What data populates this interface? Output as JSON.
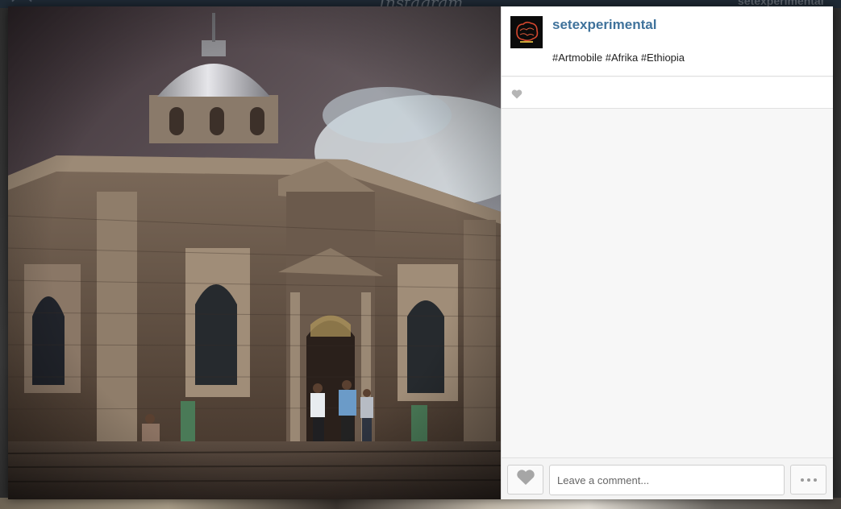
{
  "background": {
    "brand": "Instagram",
    "username": "setexperimental"
  },
  "post": {
    "username": "setexperimental",
    "caption": "#Artmobile #Afrika #Ethiopia",
    "avatar_icon": "brain-logo-icon",
    "photo_subject": "stone church with silver dome, people entering at the door"
  },
  "actions": {
    "like_icon": "heart-icon",
    "comment_placeholder": "Leave a comment...",
    "more_icon": "ellipsis-icon"
  },
  "colors": {
    "username": "#3f729b",
    "heart": "#a6a6a6"
  }
}
